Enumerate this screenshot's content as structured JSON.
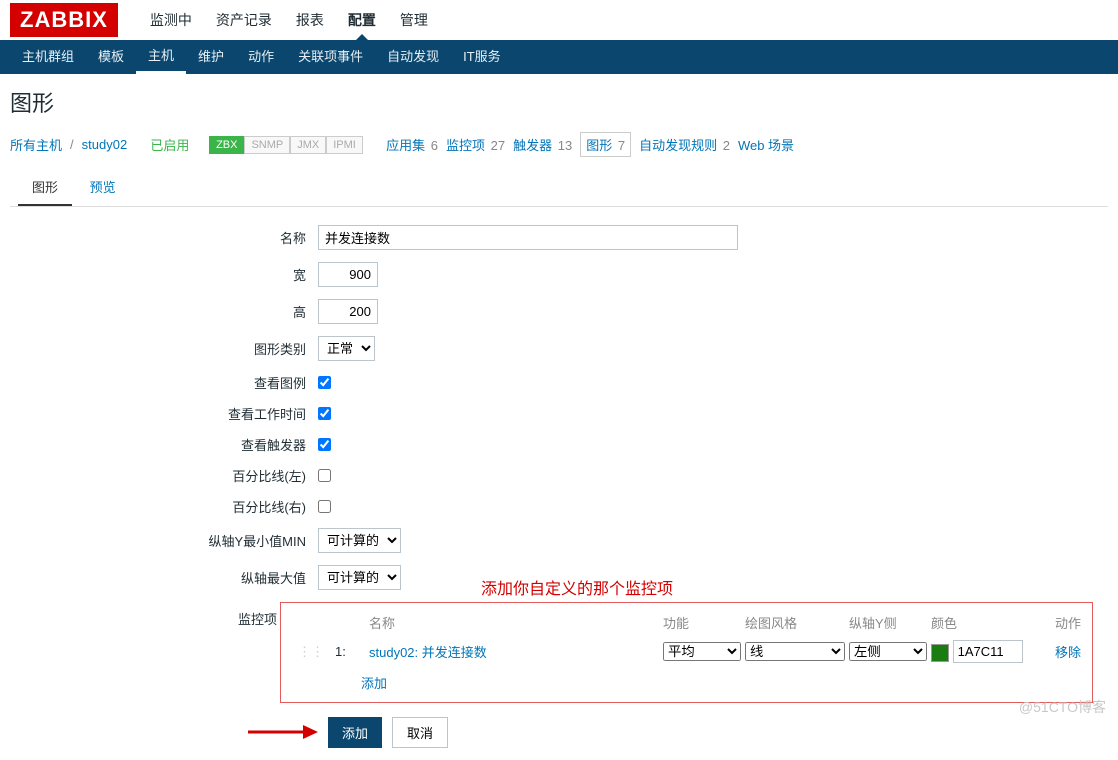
{
  "logo": "ZABBIX",
  "topnav": {
    "items": [
      "监测中",
      "资产记录",
      "报表",
      "配置",
      "管理"
    ],
    "active": "配置"
  },
  "subnav": {
    "items": [
      "主机群组",
      "模板",
      "主机",
      "维护",
      "动作",
      "关联项事件",
      "自动发现",
      "IT服务"
    ],
    "active": "主机"
  },
  "title": "图形",
  "breadcrumb": {
    "all_hosts": "所有主机",
    "host": "study02",
    "enabled": "已启用",
    "badges": [
      "ZBX",
      "SNMP",
      "JMX",
      "IPMI"
    ],
    "links": [
      {
        "label": "应用集",
        "count": "6"
      },
      {
        "label": "监控项",
        "count": "27"
      },
      {
        "label": "触发器",
        "count": "13"
      },
      {
        "label": "图形",
        "count": "7",
        "selected": true
      },
      {
        "label": "自动发现规则",
        "count": "2"
      },
      {
        "label": "Web 场景",
        "count": ""
      }
    ]
  },
  "tabs": {
    "items": [
      "图形",
      "预览"
    ],
    "active": "图形"
  },
  "form": {
    "name_label": "名称",
    "name_value": "并发连接数",
    "width_label": "宽",
    "width_value": "900",
    "height_label": "高",
    "height_value": "200",
    "type_label": "图形类别",
    "type_value": "正常",
    "legend_label": "查看图例",
    "legend_checked": true,
    "worktime_label": "查看工作时间",
    "worktime_checked": true,
    "triggers_label": "查看触发器",
    "triggers_checked": true,
    "pleft_label": "百分比线(左)",
    "pleft_checked": false,
    "pright_label": "百分比线(右)",
    "pright_checked": false,
    "ymin_label": "纵轴Y最小值MIN",
    "ymin_value": "可计算的",
    "ymax_label": "纵轴最大值",
    "ymax_value": "可计算的"
  },
  "annotation": "添加你自定义的那个监控项",
  "items": {
    "header_label": "监控项",
    "headers": {
      "name": "名称",
      "func": "功能",
      "draw": "绘图风格",
      "yside": "纵轴Y侧",
      "color": "颜色",
      "action": "动作"
    },
    "row": {
      "idx": "1:",
      "name": "study02: 并发连接数",
      "func": "平均",
      "draw": "线",
      "yside": "左侧",
      "color_hex": "1A7C11",
      "remove": "移除"
    },
    "add": "添加"
  },
  "buttons": {
    "add": "添加",
    "cancel": "取消"
  },
  "watermark": "@51CTO博客"
}
